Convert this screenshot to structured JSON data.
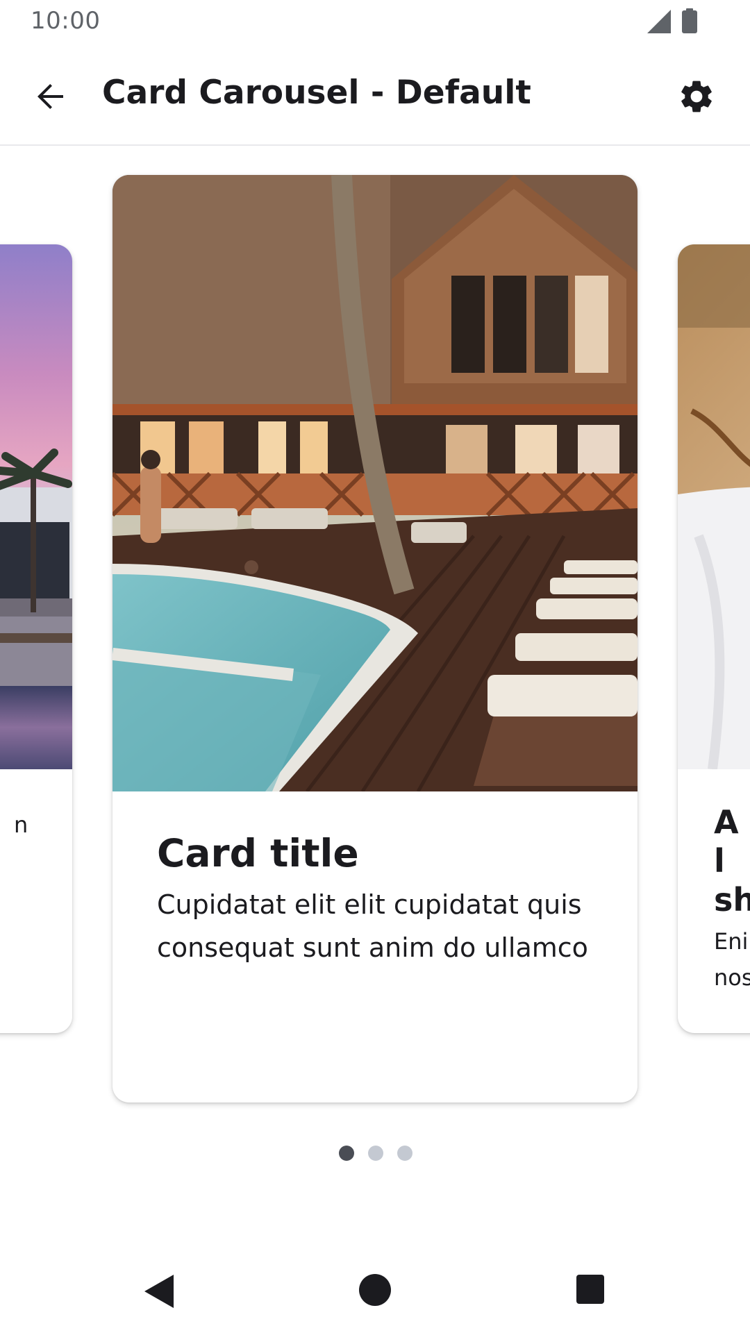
{
  "status_bar": {
    "time": "10:00",
    "icons": [
      "signal-icon",
      "battery-icon"
    ]
  },
  "app_bar": {
    "title": "Card Carousel - Default",
    "back_icon": "arrow-back-icon",
    "settings_icon": "gear-icon"
  },
  "carousel": {
    "cards": [
      {
        "position": "previous",
        "image": "resort pool with palm trees at dusk",
        "title": "",
        "text": "n"
      },
      {
        "position": "current",
        "image": "wooden lodge with pool and sun loungers",
        "title": "Card title",
        "text": "Cupidatat elit elit cupidatat quis consequat sunt anim do ullamco"
      },
      {
        "position": "next",
        "image": "person in white towel",
        "title": "A l sh",
        "text": "Enir nos"
      }
    ],
    "page_indicator": {
      "total": 3,
      "active_index": 0
    }
  },
  "nav_bar": {
    "icons": [
      "nav-back-icon",
      "nav-home-icon",
      "nav-recents-icon"
    ]
  },
  "colors": {
    "text": "#1b1b1f",
    "indicator_active": "#4a4d55",
    "indicator_inactive": "#c4c9d2",
    "divider": "#e8e8ec"
  }
}
